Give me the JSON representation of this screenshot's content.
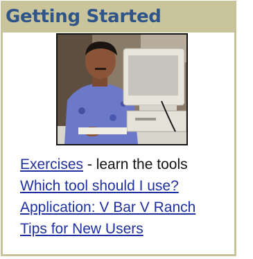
{
  "panel": {
    "title": "Getting Started",
    "photo_alt": "man-at-computer-photo"
  },
  "links": [
    {
      "label": "Exercises",
      "suffix": " - learn the tools"
    },
    {
      "label": "Which tool should I use?",
      "suffix": ""
    },
    {
      "label": "Application: V Bar V Ranch",
      "suffix": ""
    },
    {
      "label": "Tips for New Users",
      "suffix": ""
    }
  ],
  "colors": {
    "header_bg": "#c9c49c",
    "title": "#2f5488",
    "link": "#1f2fa0"
  }
}
